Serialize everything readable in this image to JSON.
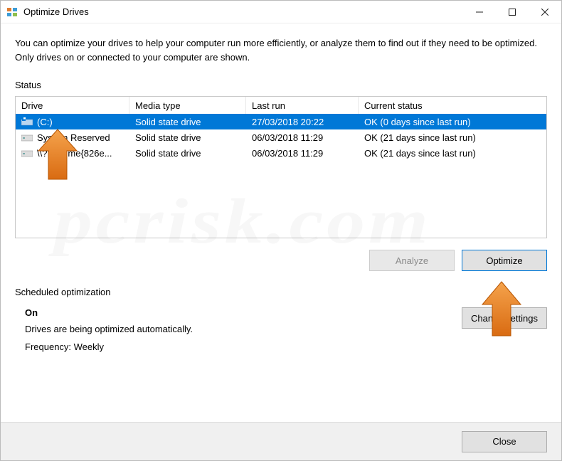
{
  "window": {
    "title": "Optimize Drives"
  },
  "description": "You can optimize your drives to help your computer run more efficiently, or analyze them to find out if they need to be optimized. Only drives on or connected to your computer are shown.",
  "status_label": "Status",
  "columns": {
    "drive": "Drive",
    "media": "Media type",
    "lastrun": "Last run",
    "status": "Current status"
  },
  "drives": [
    {
      "name": "(C:)",
      "media": "Solid state drive",
      "lastrun": "27/03/2018 20:22",
      "status": "OK (0 days since last run)",
      "selected": true,
      "icon": "windows-drive-icon"
    },
    {
      "name": "System Reserved",
      "media": "Solid state drive",
      "lastrun": "06/03/2018 11:29",
      "status": "OK (21 days since last run)",
      "selected": false,
      "icon": "hdd-icon"
    },
    {
      "name": "\\\\?\\Volume{826e...",
      "media": "Solid state drive",
      "lastrun": "06/03/2018 11:29",
      "status": "OK (21 days since last run)",
      "selected": false,
      "icon": "hdd-icon"
    }
  ],
  "buttons": {
    "analyze": "Analyze",
    "optimize": "Optimize",
    "change_settings": "Change settings",
    "close": "Close"
  },
  "scheduled": {
    "label": "Scheduled optimization",
    "on": "On",
    "line1": "Drives are being optimized automatically.",
    "line2": "Frequency: Weekly"
  },
  "watermark": "pcrisk.com"
}
